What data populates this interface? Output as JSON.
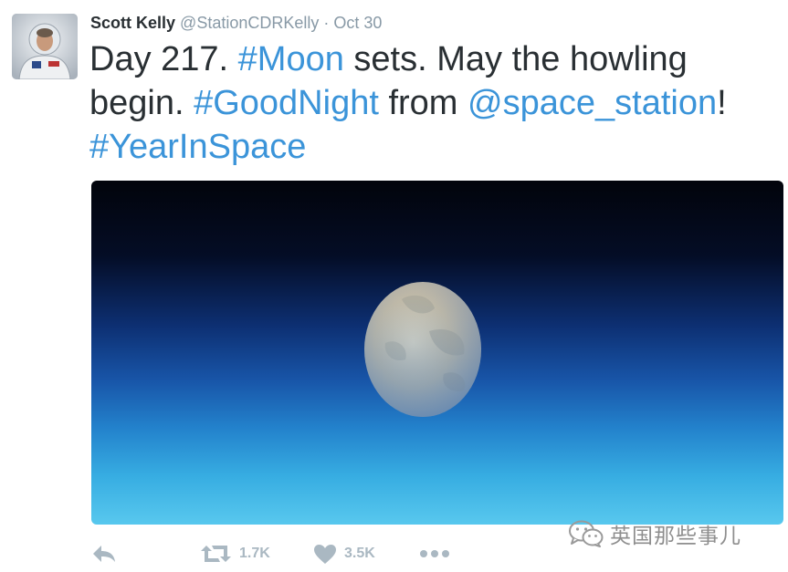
{
  "tweet": {
    "author": {
      "name": "Scott Kelly",
      "handle": "@StationCDRKelly",
      "separator": "·",
      "time": "Oct 30",
      "avatar_icon": "astronaut-avatar"
    },
    "text": {
      "t1": "Day 217. ",
      "hashtag_moon": "#Moon",
      "t2": " sets. May the howling begin. ",
      "hashtag_goodnight": "#GoodNight",
      "t3": " from ",
      "mention": "@space_station",
      "t4": "!",
      "hashtag_year": "#YearInSpace"
    },
    "media": {
      "description_icon": "moon-over-earth-photo"
    },
    "actions": {
      "reply_icon": "reply-icon",
      "retweet_icon": "retweet-icon",
      "retweet_count": "1.7K",
      "like_icon": "heart-icon",
      "like_count": "3.5K",
      "more_icon": "more-icon"
    }
  },
  "watermark": {
    "text": "英国那些事儿",
    "icon": "wechat-icon"
  },
  "colors": {
    "link": "#3b94d9",
    "text": "#292f33",
    "meta": "#8899a6",
    "action": "#aab8c2"
  }
}
